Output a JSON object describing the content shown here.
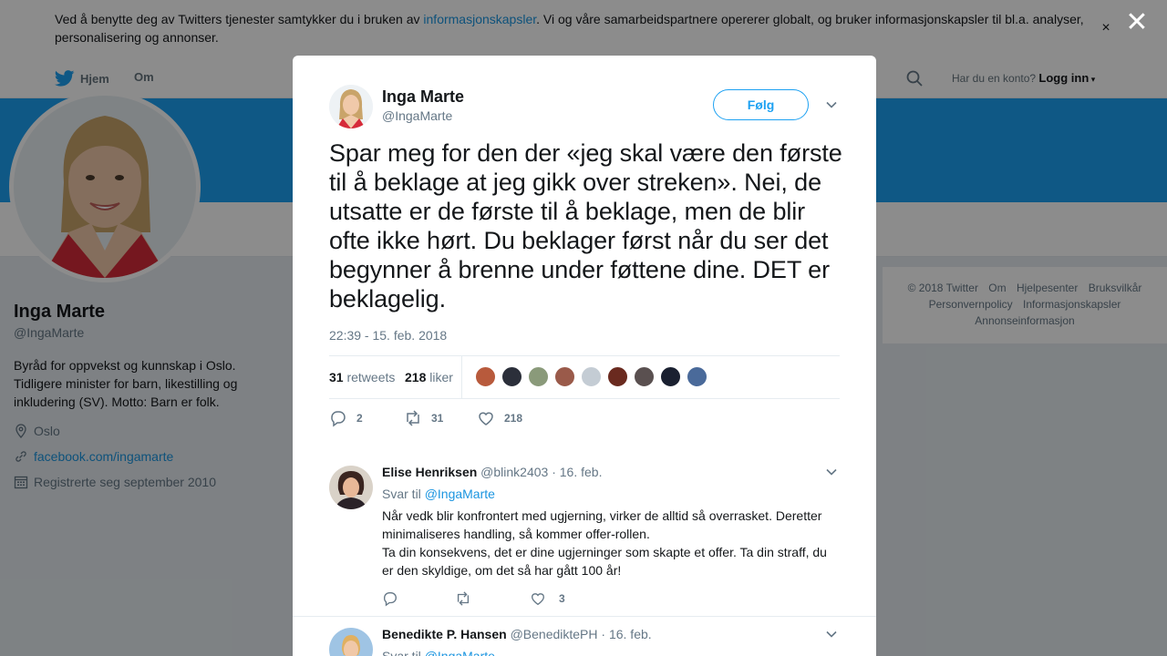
{
  "cookie_banner": {
    "text_before": "Ved å benytte deg av Twitters tjenester samtykker du i bruken av ",
    "link": "informasjonskapsler",
    "text_after": ". Vi og våre samarbeidspartnere opererer globalt, og bruker informasjonskapsler til bl.a. analyser, personalisering og annonser.",
    "close": "×"
  },
  "nav": {
    "home": "Hjem",
    "about": "Om",
    "login_prompt": "Har du en konto?",
    "login": "Logg inn"
  },
  "profile": {
    "name": "Inga Marte",
    "handle": "@IngaMarte",
    "bio": "Byråd for oppvekst og kunnskap i Oslo. Tidligere minister for barn, likestilling og inkludering (SV). Motto: Barn er folk.",
    "location": "Oslo",
    "website": "facebook.com/ingamarte",
    "joined": "Registrerte seg september 2010"
  },
  "footer": {
    "links": [
      "© 2018 Twitter",
      "Om",
      "Hjelpesenter",
      "Bruksvilkår",
      "Personvernpolicy",
      "Informasjonskapsler",
      "Annonseinformasjon"
    ]
  },
  "overlay_close": "✕",
  "tweet": {
    "author_name": "Inga Marte",
    "author_handle": "@IngaMarte",
    "follow": "Følg",
    "text": "Spar meg for den der «jeg skal være den første til å beklage at jeg gikk over streken». Nei, de utsatte er de første til å beklage, men de blir ofte ikke hørt. Du beklager først når du ser det begynner å brenne under føttene dine. DET er beklagelig.",
    "time": "22:39 - 15. feb. 2018",
    "retweets_count": "31",
    "retweets_label": "retweets",
    "likes_count": "218",
    "likes_label": "liker",
    "liker_colors": [
      "#b85a3c",
      "#2b2f3a",
      "#8a9a7a",
      "#9a5a4a",
      "#c4ccd4",
      "#6a2a1f",
      "#5a5050",
      "#1a2030",
      "#4a6a9a"
    ],
    "reply_count": "2",
    "retweet_count": "31",
    "like_count": "218"
  },
  "replies": [
    {
      "name": "Elise Henriksen",
      "handle": "@blink2403",
      "date": "· 16. feb.",
      "reply_to_label": "Svar til",
      "reply_to": "@IngaMarte",
      "text_1": "Når vedk blir konfrontert med ugjerning, virker de alltid så overrasket. Deretter minimaliseres handling, så kommer offer-rollen.",
      "text_2": "Ta din konsekvens, det er dine ugjerninger som skapte et offer. Ta din straff, du er den skyldige, om det så har gått 100 år!",
      "like_count": "3"
    },
    {
      "name": "Benedikte P. Hansen",
      "handle": "@BenediktePH",
      "date": "· 16. feb.",
      "reply_to_label": "Svar til",
      "reply_to": "@IngaMarte"
    }
  ]
}
